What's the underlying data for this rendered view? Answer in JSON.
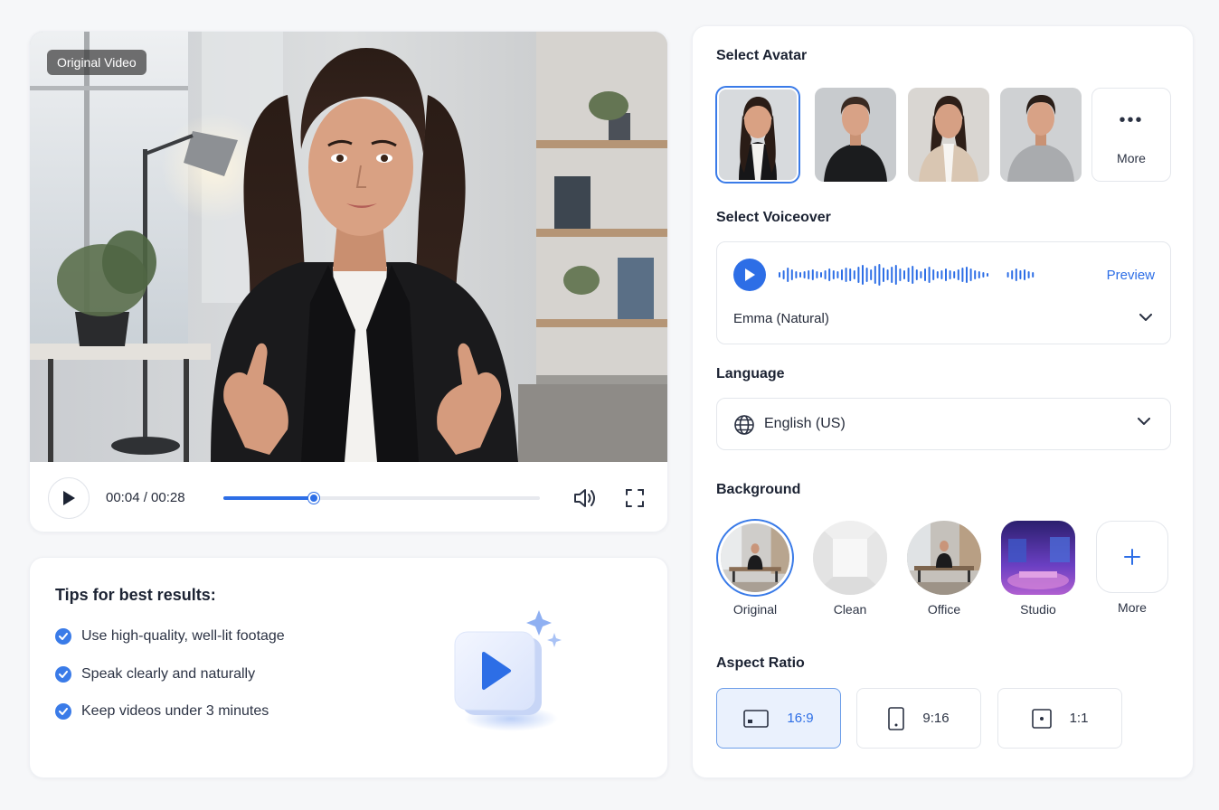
{
  "video": {
    "badge": "Original Video",
    "time_display": "00:04 / 00:28",
    "progress_fraction": 0.2857
  },
  "tips": {
    "title": "Tips for best results:",
    "items": [
      "Use high-quality, well-lit footage",
      "Speak clearly and naturally",
      "Keep videos under 3 minutes"
    ]
  },
  "settings": {
    "avatar": {
      "title": "Select Avatar",
      "more_label": "More",
      "selected_index": 0
    },
    "voiceover": {
      "title": "Select Voiceover",
      "preview_label": "Preview",
      "selected_voice": "Emma (Natural)"
    },
    "language": {
      "title": "Language",
      "selected": "English (US)"
    },
    "background": {
      "title": "Background",
      "options": [
        "Original",
        "Clean",
        "Office",
        "Studio"
      ],
      "more_label": "More",
      "selected_index": 0
    },
    "aspect_ratio": {
      "title": "Aspect Ratio",
      "options": [
        "16:9",
        "9:16",
        "1:1"
      ],
      "selected_index": 0
    }
  },
  "colors": {
    "accent": "#2d6ee6",
    "page_background": "#f6f7f9",
    "card_background": "#ffffff"
  },
  "icons": [
    "play-icon",
    "volume-icon",
    "fullscreen-icon",
    "check-icon",
    "more-dots-icon",
    "waveform-icon",
    "chevron-down-icon",
    "globe-icon",
    "plus-icon",
    "landscape-icon",
    "portrait-icon",
    "square-icon"
  ]
}
